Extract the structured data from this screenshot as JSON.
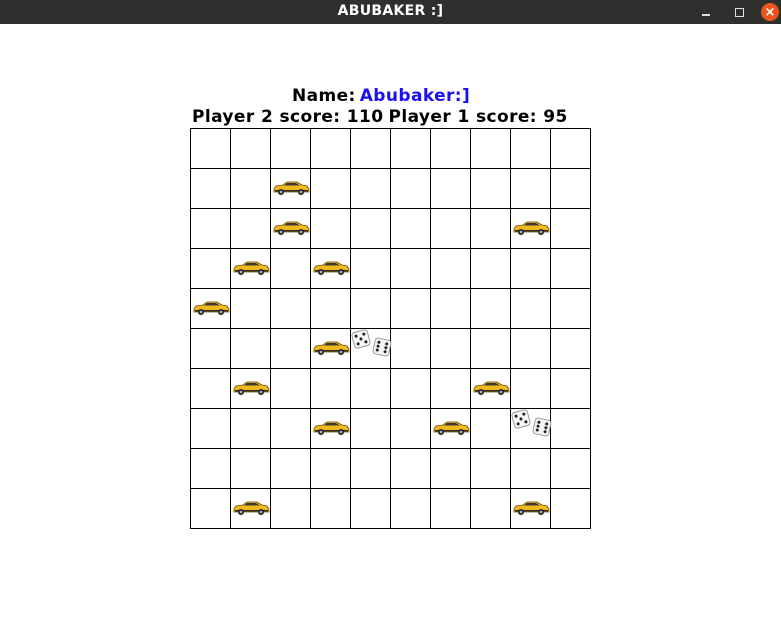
{
  "window": {
    "title": "ABUBAKER :]",
    "minimize_symbol": "",
    "close_symbol": "×"
  },
  "header": {
    "name_label": "Name:",
    "name_value": "Abubaker:]",
    "player2_score": "Player 2 score: 110",
    "player1_score": "Player 1 score: 95"
  },
  "board": {
    "rows": 10,
    "cols": 10,
    "pieces": [
      {
        "type": "car",
        "row": 1,
        "col": 2
      },
      {
        "type": "car",
        "row": 2,
        "col": 2
      },
      {
        "type": "car",
        "row": 2,
        "col": 8
      },
      {
        "type": "car",
        "row": 3,
        "col": 1
      },
      {
        "type": "car",
        "row": 3,
        "col": 3
      },
      {
        "type": "car",
        "row": 4,
        "col": 0
      },
      {
        "type": "car",
        "row": 5,
        "col": 3
      },
      {
        "type": "dice",
        "row": 5,
        "col": 4
      },
      {
        "type": "car",
        "row": 6,
        "col": 1
      },
      {
        "type": "car",
        "row": 6,
        "col": 7
      },
      {
        "type": "car",
        "row": 7,
        "col": 3
      },
      {
        "type": "car",
        "row": 7,
        "col": 6
      },
      {
        "type": "dice",
        "row": 7,
        "col": 8
      },
      {
        "type": "car",
        "row": 9,
        "col": 1
      },
      {
        "type": "car",
        "row": 9,
        "col": 8
      }
    ]
  },
  "colors": {
    "titlebar": "#2f2f2e",
    "close_button": "#e9541f",
    "name_value": "#1a0ef5",
    "car_body": "#f2b81c"
  }
}
